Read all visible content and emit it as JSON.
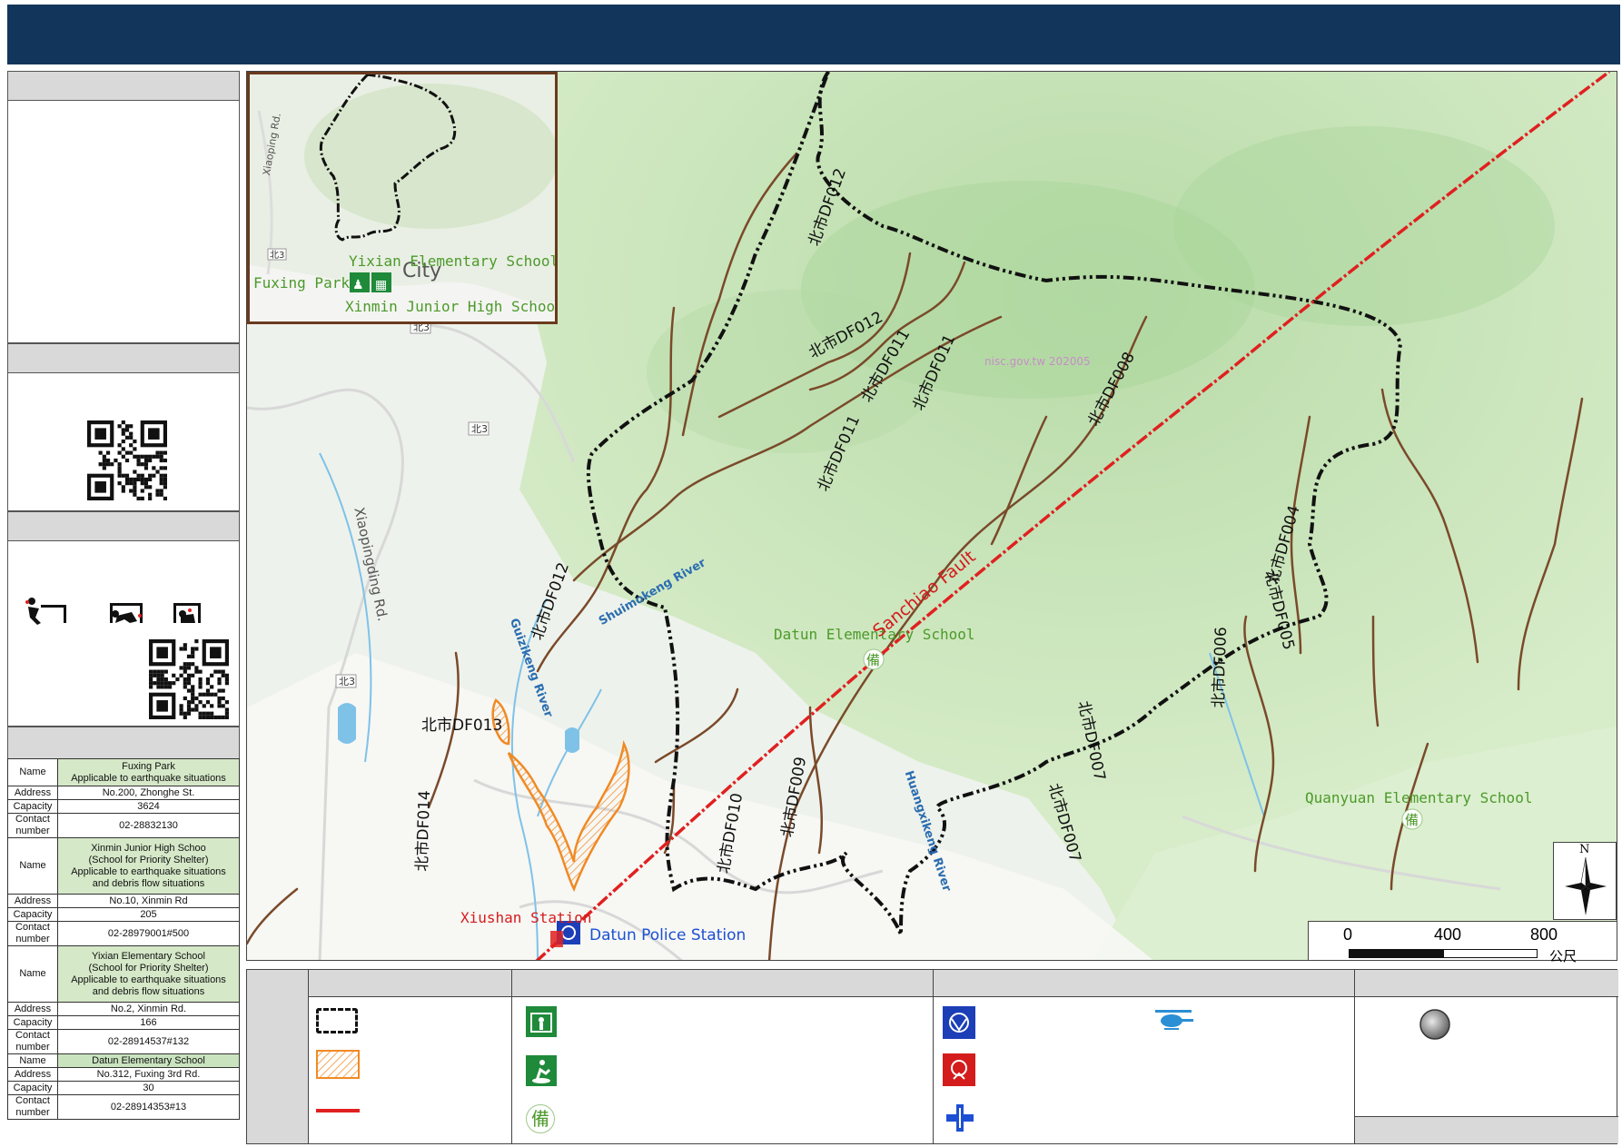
{
  "map": {
    "inset_labels": {
      "yixian": "Yixian Elementary School",
      "fuxing": "Fuxing Park",
      "xinmin": "Xinmin Junior High School",
      "city": "City",
      "xiaoping": "Xiaoping Rd."
    },
    "labels": {
      "datun_school": "Datun Elementary School",
      "quanyuan_school": "Quanyuan Elementary School",
      "xiushan_station": "Xiushan Station",
      "datun_police": "Datun Police Station",
      "sanchiao_fault": "Sanchiao Fault",
      "watermark": "nisc.gov.tw 202005",
      "xiaopingding": "Xiaopingding Rd."
    },
    "debris_flows": [
      {
        "id": "df012a",
        "text": "北市DF012"
      },
      {
        "id": "df012b",
        "text": "北市DF012"
      },
      {
        "id": "df012c",
        "text": "北市DF012"
      },
      {
        "id": "df011a",
        "text": "北市DF011"
      },
      {
        "id": "df011b",
        "text": "北市DF011"
      },
      {
        "id": "df011c",
        "text": "北市DF011"
      },
      {
        "id": "df008",
        "text": "北市DF008"
      },
      {
        "id": "df013",
        "text": "北市DF013"
      },
      {
        "id": "df014",
        "text": "北市DF014"
      },
      {
        "id": "df010",
        "text": "北市DF010"
      },
      {
        "id": "df009",
        "text": "北市DF009"
      },
      {
        "id": "df007a",
        "text": "北市DF007"
      },
      {
        "id": "df007b",
        "text": "北市DF007"
      },
      {
        "id": "df006",
        "text": "北市DF006"
      },
      {
        "id": "df005",
        "text": "北市DF005"
      },
      {
        "id": "df004",
        "text": "北市DF004"
      }
    ],
    "rivers": {
      "guizikeng": "Guizikeng River",
      "shuimokeng": "Shuimokeng River",
      "huangxikeng": "Huangxikeng River"
    },
    "route_badge": "北3",
    "shelter_glyph": "備"
  },
  "scale": {
    "ticks": [
      "0",
      "400",
      "800"
    ],
    "unit": "公尺"
  },
  "north_label": "N",
  "shelters": {
    "labels": {
      "name": "Name",
      "address": "Address",
      "capacity": "Capacity",
      "contact": "Contact number"
    },
    "items": [
      {
        "name": [
          "Fuxing Park",
          "Applicable to earthquake situations"
        ],
        "address": "No.200, Zhonghe St.",
        "capacity": "3624",
        "contact": "02-28832130"
      },
      {
        "name": [
          "Xinmin Junior High Schoo",
          "(School for Priority Shelter)",
          "Applicable to earthquake situations",
          "and debris flow situations"
        ],
        "address": "No.10, Xinmin Rd",
        "capacity": "205",
        "contact": "02-28979001#500"
      },
      {
        "name": [
          "Yixian Elementary School",
          "(School for Priority Shelter)",
          "Applicable to earthquake situations",
          "and debris flow situations"
        ],
        "address": "No.2, Xinmin Rd.",
        "capacity": "166",
        "contact": "02-28914537#132"
      },
      {
        "name": [
          "Datun Elementary School"
        ],
        "address": "No.312, Fuxing 3rd Rd.",
        "capacity": "30",
        "contact": "02-28914353#13"
      }
    ]
  },
  "colors": {
    "header": "#12365b",
    "fault": "#e02020",
    "boundary": "#111111",
    "debris": "#7a4a2a",
    "hazard": "#f08a24",
    "shelter_green": "#1f8a3a",
    "police": "#1c3fb8"
  }
}
